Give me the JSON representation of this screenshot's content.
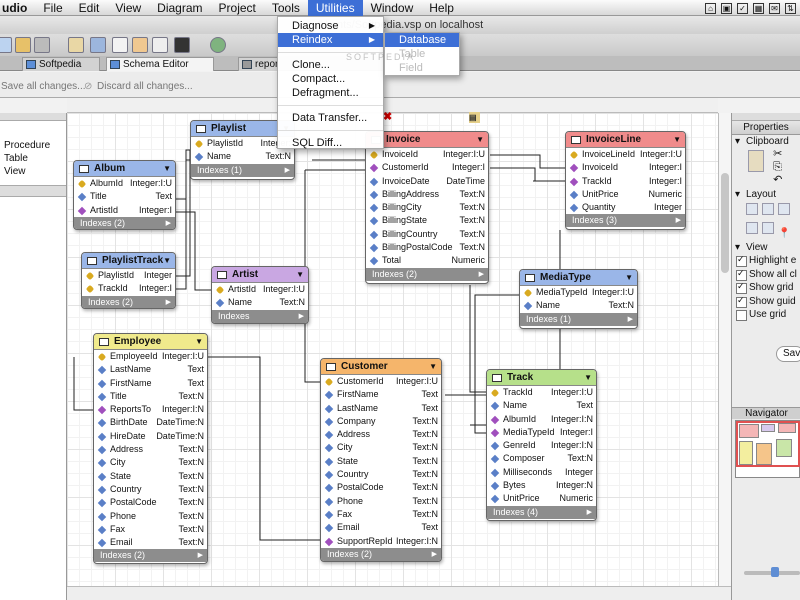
{
  "menubar": {
    "app": "udio",
    "items": [
      "File",
      "Edit",
      "View",
      "Diagram",
      "Project",
      "Tools",
      "Utilities",
      "Window",
      "Help"
    ],
    "active": "Utilities"
  },
  "window_title": "/U                ents/Softpedia.vsp on localhost",
  "tabs": [
    "Softpedia",
    "Schema Editor",
    "repor"
  ],
  "actions": {
    "save": "Save all changes...",
    "discard": "Discard all changes..."
  },
  "left_panel": {
    "items": [
      "Procedure",
      "Table",
      "View"
    ]
  },
  "utilities_menu": {
    "items": [
      {
        "label": "Diagnose",
        "submenu": true
      },
      {
        "label": "Reindex",
        "submenu": true
      },
      {
        "label": "Clone..."
      },
      {
        "label": "Compact..."
      },
      {
        "label": "Defragment..."
      },
      {
        "label": "Data Transfer..."
      },
      {
        "label": "SQL Diff..."
      }
    ]
  },
  "reindex_submenu": [
    "Database",
    "Table",
    "Field"
  ],
  "watermark": "SOFTPEDIA",
  "entities": {
    "playlist": {
      "name": "Playlist",
      "color": "#9ab6e8",
      "rows": [
        [
          "pk",
          "PlaylistId",
          "Integer:"
        ],
        [
          "co",
          "Name",
          "Text:N"
        ]
      ],
      "indexes": "Indexes (1)"
    },
    "album": {
      "name": "Album",
      "color": "#9ab6e8",
      "rows": [
        [
          "pk",
          "AlbumId",
          "Integer:I:U"
        ],
        [
          "co",
          "Title",
          "Text"
        ],
        [
          "fk",
          "ArtistId",
          "Integer:I"
        ]
      ],
      "indexes": "Indexes (2)"
    },
    "playlisttrack": {
      "name": "PlaylistTrack",
      "color": "#9ab6e8",
      "rows": [
        [
          "pk",
          "PlaylistId",
          "Integer"
        ],
        [
          "pk",
          "TrackId",
          "Integer:I"
        ]
      ],
      "indexes": "Indexes (2)"
    },
    "artist": {
      "name": "Artist",
      "color": "#c9a7e2",
      "rows": [
        [
          "pk",
          "ArtistId",
          "Integer:I:U"
        ],
        [
          "co",
          "Name",
          "Text:N"
        ]
      ],
      "indexes": "Indexes"
    },
    "invoice": {
      "name": "Invoice",
      "color": "#f08b8b",
      "rows": [
        [
          "pk",
          "InvoiceId",
          "Integer:I:U"
        ],
        [
          "fk",
          "CustomerId",
          "Integer:I"
        ],
        [
          "co",
          "InvoiceDate",
          "DateTime"
        ],
        [
          "co",
          "BillingAddress",
          "Text:N"
        ],
        [
          "co",
          "BillingCity",
          "Text:N"
        ],
        [
          "co",
          "BillingState",
          "Text:N"
        ],
        [
          "co",
          "BillingCountry",
          "Text:N"
        ],
        [
          "co",
          "BillingPostalCode",
          "Text:N"
        ],
        [
          "co",
          "Total",
          "Numeric"
        ]
      ],
      "indexes": "Indexes (2)"
    },
    "invoiceline": {
      "name": "InvoiceLine",
      "color": "#f08b8b",
      "rows": [
        [
          "pk",
          "InvoiceLineId",
          "Integer:I:U"
        ],
        [
          "fk",
          "InvoiceId",
          "Integer:I"
        ],
        [
          "fk",
          "TrackId",
          "Integer:I"
        ],
        [
          "co",
          "UnitPrice",
          "Numeric"
        ],
        [
          "co",
          "Quantity",
          "Integer"
        ]
      ],
      "indexes": "Indexes (3)"
    },
    "mediatype": {
      "name": "MediaType",
      "color": "#9ab6e8",
      "rows": [
        [
          "pk",
          "MediaTypeId",
          "Integer:I:U"
        ],
        [
          "co",
          "Name",
          "Text:N"
        ]
      ],
      "indexes": "Indexes (1)"
    },
    "employee": {
      "name": "Employee",
      "color": "#f0ea8c",
      "rows": [
        [
          "pk",
          "EmployeeId",
          "Integer:I:U"
        ],
        [
          "co",
          "LastName",
          "Text"
        ],
        [
          "co",
          "FirstName",
          "Text"
        ],
        [
          "co",
          "Title",
          "Text:N"
        ],
        [
          "fk",
          "ReportsTo",
          "Integer:I:N"
        ],
        [
          "co",
          "BirthDate",
          "DateTime:N"
        ],
        [
          "co",
          "HireDate",
          "DateTime:N"
        ],
        [
          "co",
          "Address",
          "Text:N"
        ],
        [
          "co",
          "City",
          "Text:N"
        ],
        [
          "co",
          "State",
          "Text:N"
        ],
        [
          "co",
          "Country",
          "Text:N"
        ],
        [
          "co",
          "PostalCode",
          "Text:N"
        ],
        [
          "co",
          "Phone",
          "Text:N"
        ],
        [
          "co",
          "Fax",
          "Text:N"
        ],
        [
          "co",
          "Email",
          "Text:N"
        ]
      ],
      "indexes": "Indexes (2)"
    },
    "customer": {
      "name": "Customer",
      "color": "#f5b56b",
      "rows": [
        [
          "pk",
          "CustomerId",
          "Integer:I:U"
        ],
        [
          "co",
          "FirstName",
          "Text"
        ],
        [
          "co",
          "LastName",
          "Text"
        ],
        [
          "co",
          "Company",
          "Text:N"
        ],
        [
          "co",
          "Address",
          "Text:N"
        ],
        [
          "co",
          "City",
          "Text:N"
        ],
        [
          "co",
          "State",
          "Text:N"
        ],
        [
          "co",
          "Country",
          "Text:N"
        ],
        [
          "co",
          "PostalCode",
          "Text:N"
        ],
        [
          "co",
          "Phone",
          "Text:N"
        ],
        [
          "co",
          "Fax",
          "Text:N"
        ],
        [
          "co",
          "Email",
          "Text"
        ],
        [
          "fk",
          "SupportRepId",
          "Integer:I:N"
        ]
      ],
      "indexes": "Indexes (2)"
    },
    "track": {
      "name": "Track",
      "color": "#b6e08a",
      "rows": [
        [
          "pk",
          "TrackId",
          "Integer:I:U"
        ],
        [
          "co",
          "Name",
          "Text"
        ],
        [
          "fk",
          "AlbumId",
          "Integer:I:N"
        ],
        [
          "fk",
          "MediaTypeId",
          "Integer:I"
        ],
        [
          "fk",
          "GenreId",
          "Integer:I:N"
        ],
        [
          "co",
          "Composer",
          "Text:N"
        ],
        [
          "co",
          "Milliseconds",
          "Integer"
        ],
        [
          "co",
          "Bytes",
          "Integer:N"
        ],
        [
          "co",
          "UnitPrice",
          "Numeric"
        ]
      ],
      "indexes": "Indexes (4)"
    }
  },
  "properties": {
    "title": "Properties",
    "clipboard": "Clipboard",
    "layout": "Layout",
    "view": "View",
    "checks": [
      {
        "label": "Highlight e",
        "on": true
      },
      {
        "label": "Show all cl",
        "on": true
      },
      {
        "label": "Show grid",
        "on": true
      },
      {
        "label": "Show guid",
        "on": true
      },
      {
        "label": "Use grid",
        "on": false
      }
    ],
    "save": "Save",
    "navigator": "Navigator"
  }
}
